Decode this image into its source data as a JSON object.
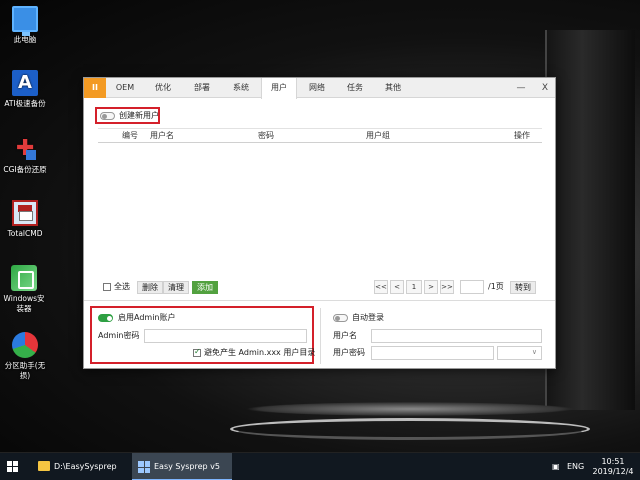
{
  "desktop": {
    "icons": [
      {
        "label": "此电脑",
        "icon": "computer-icon"
      },
      {
        "label": "ATI极速备份",
        "icon": "ati-backup-icon"
      },
      {
        "label": "CGI备份还原",
        "icon": "cgi-restore-icon"
      },
      {
        "label": "TotalCMD",
        "icon": "totalcmd-icon"
      },
      {
        "label": "Windows安装器",
        "icon": "windows-installer-icon"
      },
      {
        "label": "分区助手(无损)",
        "icon": "partition-assistant-icon"
      }
    ]
  },
  "window": {
    "logo": "II",
    "tabs": [
      "OEM",
      "优化",
      "部署",
      "系统",
      "用户",
      "网络",
      "任务",
      "其他"
    ],
    "active_tab": "用户",
    "minimize": "—",
    "close": "X",
    "create_user": {
      "label": "创建新用户",
      "enabled": false
    },
    "table": {
      "headers": {
        "index": "编号",
        "username": "用户名",
        "password": "密码",
        "group": "用户组",
        "action": "操作"
      },
      "rows": []
    },
    "footer": {
      "select_all": "全选",
      "delete": "删除",
      "clear": "清理",
      "add": "添加",
      "pager": {
        "first": "<<",
        "prev": "<",
        "page": "1",
        "next": ">",
        "last": ">>",
        "total": "/1页",
        "goto": "转到"
      }
    },
    "admin": {
      "toggle_label": "启用Admin账户",
      "enabled": true,
      "password_label": "Admin密码",
      "password_value": "",
      "avoid_label": "避免产生 Admin.xxx 用户目录",
      "avoid_checked": true
    },
    "autologin": {
      "toggle_label": "自动登录",
      "enabled": false,
      "username_label": "用户名",
      "password_label": "用户密码",
      "username_value": "",
      "password_value": ""
    }
  },
  "taskbar": {
    "items": [
      {
        "label": "D:\\EasySysprep",
        "active": false
      },
      {
        "label": "Easy Sysprep v5 -...",
        "active": true
      }
    ],
    "lang": "ENG",
    "time": "10:51",
    "date": "2019/12/4"
  },
  "colors": {
    "accent_orange": "#f39a23",
    "highlight_red": "#d4202a",
    "toggle_green": "#2ea043",
    "add_button": "#52a13f"
  }
}
